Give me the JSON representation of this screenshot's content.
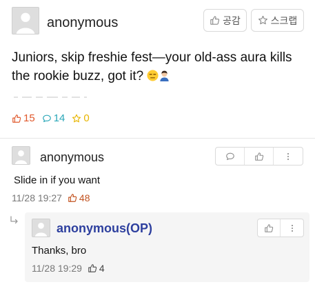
{
  "post": {
    "author": "anonymous",
    "like_button_label": "공감",
    "scrap_button_label": "스크랩",
    "body": "Juniors, skip freshie fest—your old-ass aura kills the rookie buzz, got it?",
    "stats": {
      "likes": "15",
      "comments": "14",
      "scraps": "0"
    }
  },
  "comments": [
    {
      "author": "anonymous",
      "body": "Slide in if you want",
      "timestamp": "11/28 19:27",
      "likes": "48"
    }
  ],
  "replies": [
    {
      "author": "anonymous(OP)",
      "body": "Thanks, bro",
      "timestamp": "11/28 19:29",
      "likes": "4"
    }
  ],
  "icons": {
    "post_emoji_1": "unamused-face-emoji",
    "post_emoji_2": "person-emoji",
    "like": "thumbs-up-icon",
    "comment": "speech-bubble-icon",
    "scrap": "star-icon",
    "more": "kebab-menu-icon",
    "reply": "reply-arrow-icon"
  },
  "colors": {
    "like_accent": "#e0582b",
    "comment_accent": "#2aa7b8",
    "scrap_accent": "#e8b500",
    "op_name": "#2d3f9e"
  }
}
